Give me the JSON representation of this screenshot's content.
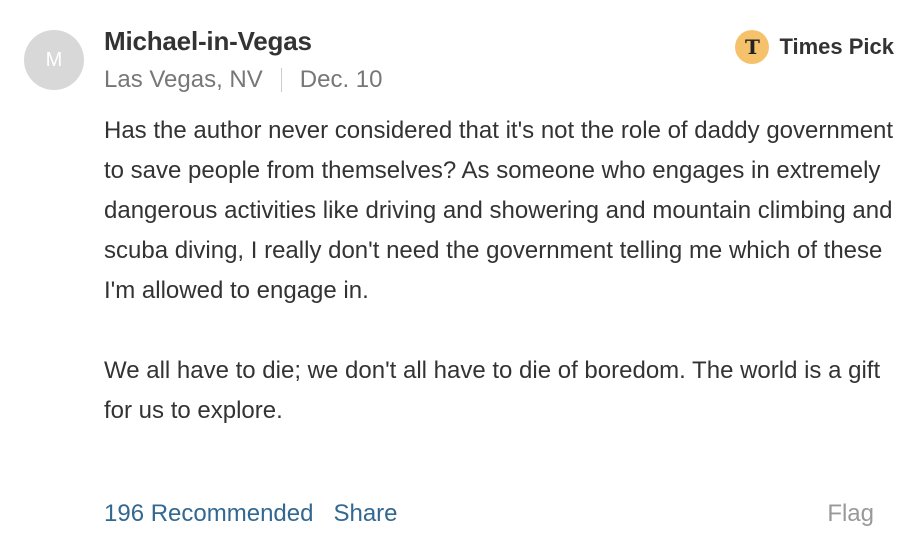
{
  "comment": {
    "avatar_initial": "M",
    "author": "Michael-in-Vegas",
    "location": "Las Vegas, NV",
    "date": "Dec. 10",
    "badge": {
      "icon": "nyt-t-logo-icon",
      "label": "Times Pick",
      "color": "#f5c26b"
    },
    "paragraphs": [
      "Has the author never considered that it's not the role of daddy government to save people from themselves? As someone who engages in extremely dangerous activities like driving and showering and mountain climbing and scuba diving, I really don't need the government telling me which of these I'm allowed to engage in.",
      "We all have to die; we don't all have to die of boredom. The world is a gift for us to explore."
    ],
    "actions": {
      "recommended": "196 Recommended",
      "share": "Share",
      "flag": "Flag"
    }
  },
  "colors": {
    "link": "#326891",
    "text": "#333333",
    "muted": "#777777",
    "avatar_bg": "#d8d8d8"
  }
}
